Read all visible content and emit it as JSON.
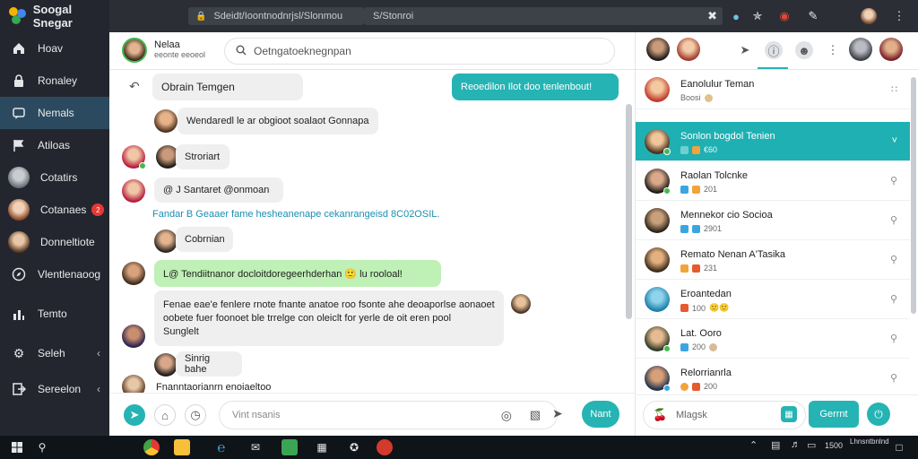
{
  "app": {
    "title": "Soogal Snegar"
  },
  "topbar": {
    "address": "Sdeidt/Ioontnodnrjsl/Slonmou",
    "tab": "S/Stonroi"
  },
  "sidebar": {
    "items": [
      {
        "label": "Hoav",
        "icon": "home-icon"
      },
      {
        "label": "Ronaley",
        "icon": "lock-icon"
      },
      {
        "label": "Nemals",
        "icon": "messages-icon"
      },
      {
        "label": "Atiloas",
        "icon": "flag-icon"
      },
      {
        "label": "Cotatirs",
        "icon": "contact-avatar"
      },
      {
        "label": "Cotanaes",
        "icon": "contact-avatar",
        "badge": "2"
      },
      {
        "label": "Donneltiote",
        "icon": "contact-avatar"
      },
      {
        "label": "Vlentlenaoog",
        "icon": "compass-icon"
      },
      {
        "label": "Temto",
        "icon": "chart-icon"
      },
      {
        "label": "Seleh",
        "icon": "gear-icon"
      },
      {
        "label": "Sereelon",
        "icon": "exit-icon"
      }
    ]
  },
  "chat": {
    "header": {
      "name": "Nelaa",
      "subtitle": "eeonte eeoeol",
      "search_placeholder": "Oetngatoeknegnpan"
    },
    "messages": [
      {
        "text": "Obrain Temgen"
      },
      {
        "text": "Reoedilon Ilot doo tenlenbout!"
      },
      {
        "text": "Wendaredl le ar obgioot soalaot Gonnapa"
      },
      {
        "text": "Stroriart"
      },
      {
        "text": "@ J Santaret @onmoan"
      },
      {
        "text": "Cobrnian"
      },
      {
        "text": "L@ Tendiitnanor docloitdoregeerhderhan 🙂 lu rooloal!"
      },
      {
        "text": "Sunglelt"
      },
      {
        "text": "Sinrig bahe"
      }
    ],
    "link_line": "Fandar B Geaaer fame hesheanenape cekanrangeisd 8C02OSIL.",
    "long_message": {
      "line1": "Fenae eae'e fenlere rnote fnante anatoe roo fsonte ahe deoaporlse aonaoet",
      "line2": "oobete fuer foonoet ble trrelge con oleiclt for yerle de oit eren pool"
    },
    "trailing_text": "Fnanntaorianrn enoiaeltoo",
    "composer": {
      "placeholder": "Vint nsanis",
      "send_label": "Nant"
    }
  },
  "contacts": {
    "items": [
      {
        "name": "Eanolulur Teman",
        "meta": "Boosi"
      },
      {
        "name": "Sonlon bogdol Tenien",
        "meta": "€60"
      },
      {
        "name": "Raolan Tolcnke",
        "meta": "201"
      },
      {
        "name": "Mennekor cio Socioa",
        "meta": "2901"
      },
      {
        "name": "Remato Nenan A'Tasika",
        "meta": "231"
      },
      {
        "name": "Eroantedan",
        "meta": "100"
      },
      {
        "name": "Lat. Ooro",
        "meta": "200"
      },
      {
        "name": "Relorrianrla",
        "meta": "200"
      }
    ],
    "composer": {
      "placeholder": "Mlagsk",
      "send_label": "Gerrnt"
    }
  },
  "taskbar": {
    "clock": "1500",
    "date": "Lhnsntbnlnd"
  },
  "colors": {
    "accent": "#26b3b4",
    "sidebar": "#23262e",
    "active_nav": "#2c4a5f",
    "bubble_green": "#bff0b6"
  }
}
